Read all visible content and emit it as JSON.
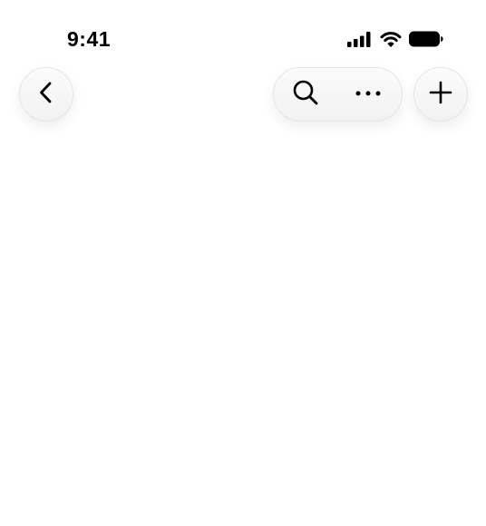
{
  "status_bar": {
    "time": "9:41",
    "icons": [
      "cellular-signal-icon",
      "wifi-icon",
      "battery-icon"
    ]
  },
  "navigation": {
    "back_icon": "chevron-left-icon",
    "actions": [
      "search-icon",
      "more-horizontal-icon"
    ],
    "add_icon": "plus-icon"
  },
  "colors": {
    "background": "#ffffff",
    "icon": "#000000",
    "button_fill": "#f5f5f5"
  }
}
